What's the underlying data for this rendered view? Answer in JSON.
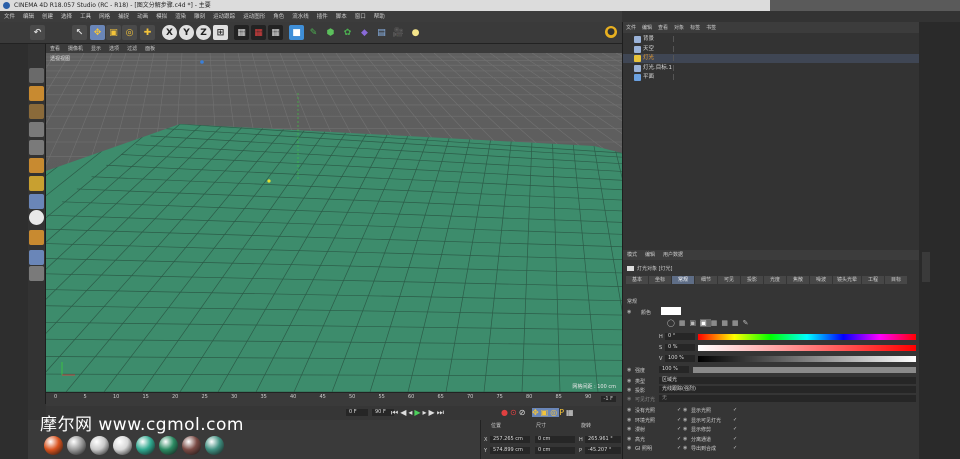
{
  "window": {
    "title": "CINEMA 4D R18.057 Studio (RC - R18) - [图文分解步骤.c4d *] - 主要"
  },
  "menubar": {
    "items": [
      "文件",
      "编辑",
      "创建",
      "选择",
      "工具",
      "网格",
      "捕捉",
      "动画",
      "模拟",
      "渲染",
      "雕刻",
      "运动跟踪",
      "运动图形",
      "角色",
      "流水线",
      "插件",
      "脚本",
      "窗口",
      "帮助"
    ]
  },
  "viewport": {
    "menu": [
      "查看",
      "摄像机",
      "显示",
      "选项",
      "过滤",
      "面板"
    ],
    "label": "透视视图",
    "grid_spacing": "网格间距 : 100 cm"
  },
  "timeline": {
    "ticks": [
      "0",
      "5",
      "10",
      "15",
      "20",
      "25",
      "30",
      "35",
      "40",
      "45",
      "50",
      "55",
      "60",
      "65",
      "70",
      "75",
      "80",
      "85",
      "90"
    ],
    "end_frame": "-1 F",
    "current_frame": "0 F",
    "max_frame": "90 F"
  },
  "object_manager": {
    "menu": [
      "文件",
      "编辑",
      "查看",
      "对象",
      "标签",
      "书签"
    ],
    "objects": [
      {
        "name": "背景",
        "icon_color": "#9ab2d8"
      },
      {
        "name": "天空",
        "icon_color": "#9ab2d8"
      },
      {
        "name": "灯光",
        "icon_color": "#e8c33a",
        "selected": true
      },
      {
        "name": "灯光.目标.1",
        "icon_color": "#9ab2d8"
      },
      {
        "name": "平面",
        "icon_color": "#6aa0e0"
      }
    ]
  },
  "attribute_manager": {
    "menu": [
      "模式",
      "编辑",
      "用户数据"
    ],
    "object_label": "灯光对象 [灯光]",
    "tabs": [
      "基本",
      "坐标",
      "常规",
      "细节",
      "可见",
      "投影",
      "光度",
      "焦散",
      "噪波",
      "镜头光晕",
      "工程",
      "目标"
    ],
    "active_tab": "常规",
    "section": "常规",
    "color_label": "颜色",
    "h_label": "H",
    "h_value": "0 °",
    "s_label": "S",
    "s_value": "0 %",
    "v_label": "V",
    "v_value": "100 %",
    "intensity_label": "强度",
    "intensity_value": "100 %",
    "type_label": "类型",
    "type_value": "区域光",
    "shadow_label": "投影",
    "shadow_value": "光线跟踪(强烈)",
    "visible_light_label": "可见灯光",
    "visible_light_value": "无",
    "checks_left": [
      "没有光照",
      "环境光照",
      "漫射",
      "高光",
      "GI 照明"
    ],
    "checks_right": [
      "显示光照",
      "显示可见灯光",
      "显示修剪",
      "分离通道",
      "导出到合成"
    ]
  },
  "coordinates": {
    "headers": [
      "位置",
      "尺寸",
      "旋转"
    ],
    "rows": [
      {
        "axis": "X",
        "pos": "257.265 cm",
        "size": "0 cm",
        "rot_label": "H",
        "rot": "265.961 °"
      },
      {
        "axis": "Y",
        "pos": "574.899 cm",
        "size": "0 cm",
        "rot_label": "P",
        "rot": "-45.207 °"
      }
    ]
  },
  "watermark": "摩尔网 www.cgmol.com",
  "materials": {
    "colors": [
      "#d9531e",
      "#9a9a9a",
      "#c9c9c9",
      "#d8d8d8",
      "#2fa88f",
      "#2b8a62",
      "#7a4a44",
      "#3f8f80"
    ]
  }
}
